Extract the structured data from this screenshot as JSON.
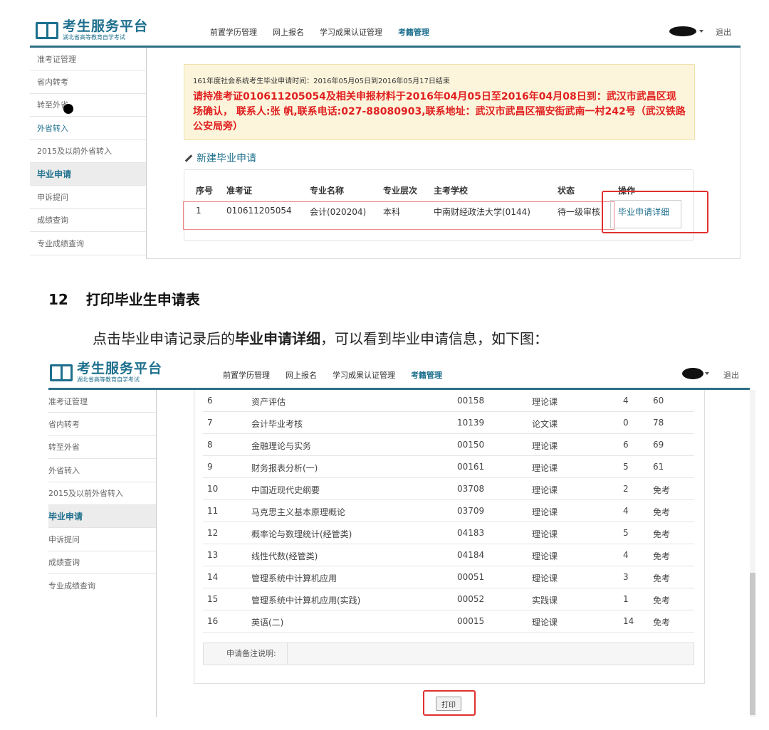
{
  "screen1": {
    "logo_title": "考生服务平台",
    "logo_sub": "湖北省高等教育自学考试",
    "nav": [
      "前置学历管理",
      "网上报名",
      "学习成果认证管理",
      "考籍管理"
    ],
    "logout": "退出",
    "sidebar": [
      "准考证管理",
      "省内转考",
      "转至外省",
      "外省转入",
      "2015及以前外省转入",
      "毕业申请",
      "申诉提问",
      "成绩查询",
      "专业成绩查询"
    ],
    "notice_small": "161年度社会系统考生毕业申请时间：2016年05月05日到2016年05月17日结束",
    "notice_big": "请持准考证010611205054及相关申报材料于2016年04月05日至2016年04月08日到：武汉市武昌区现场确认， 联系人:张 帆,联系电话:027-88080903,联系地址：武汉市武昌区福安街武南一村242号（武汉铁路公安局旁）",
    "new_app": "新建毕业申请",
    "table_headers": [
      "序号",
      "准考证",
      "专业名称",
      "专业层次",
      "主考学校",
      "状态",
      "操作"
    ],
    "row": {
      "seq": "1",
      "ticket": "010611205054",
      "major": "会计(020204)",
      "level": "本科",
      "school": "中南财经政法大学(0144)",
      "status": "待一级审核",
      "action": "毕业申请详细"
    }
  },
  "section": {
    "number": "12",
    "title": "打印毕业生申请表",
    "desc_pre": "点击毕业申请记录后的",
    "desc_bold": "毕业申请详细",
    "desc_post": "，可以看到毕业申请信息，如下图："
  },
  "screen2": {
    "logo_title": "考生服务平台",
    "logo_sub": "湖北省高等教育自学考试",
    "nav": [
      "前置学历管理",
      "网上报名",
      "学习成果认证管理",
      "考籍管理"
    ],
    "logout": "退出",
    "sidebar": [
      "准考证管理",
      "省内转考",
      "转至外省",
      "外省转入",
      "2015及以前外省转入",
      "毕业申请",
      "申诉提问",
      "成绩查询",
      "专业成绩查询"
    ],
    "courses": [
      {
        "no": "6",
        "name": "资产评估",
        "code": "00158",
        "type": "理论课",
        "credit": "4",
        "score": "60"
      },
      {
        "no": "7",
        "name": "会计毕业考核",
        "code": "10139",
        "type": "论文课",
        "credit": "0",
        "score": "78"
      },
      {
        "no": "8",
        "name": "金融理论与实务",
        "code": "00150",
        "type": "理论课",
        "credit": "6",
        "score": "69"
      },
      {
        "no": "9",
        "name": "财务报表分析(一)",
        "code": "00161",
        "type": "理论课",
        "credit": "5",
        "score": "61"
      },
      {
        "no": "10",
        "name": "中国近现代史纲要",
        "code": "03708",
        "type": "理论课",
        "credit": "2",
        "score": "免考"
      },
      {
        "no": "11",
        "name": "马克思主义基本原理概论",
        "code": "03709",
        "type": "理论课",
        "credit": "4",
        "score": "免考"
      },
      {
        "no": "12",
        "name": "概率论与数理统计(经管类)",
        "code": "04183",
        "type": "理论课",
        "credit": "5",
        "score": "免考"
      },
      {
        "no": "13",
        "name": "线性代数(经管类)",
        "code": "04184",
        "type": "理论课",
        "credit": "4",
        "score": "免考"
      },
      {
        "no": "14",
        "name": "管理系统中计算机应用",
        "code": "00051",
        "type": "理论课",
        "credit": "3",
        "score": "免考"
      },
      {
        "no": "15",
        "name": "管理系统中计算机应用(实践)",
        "code": "00052",
        "type": "实践课",
        "credit": "1",
        "score": "免考"
      },
      {
        "no": "16",
        "name": "英语(二)",
        "code": "00015",
        "type": "理论课",
        "credit": "14",
        "score": "免考"
      }
    ],
    "remark_label": "申请备注说明:",
    "print_label": "打印"
  }
}
